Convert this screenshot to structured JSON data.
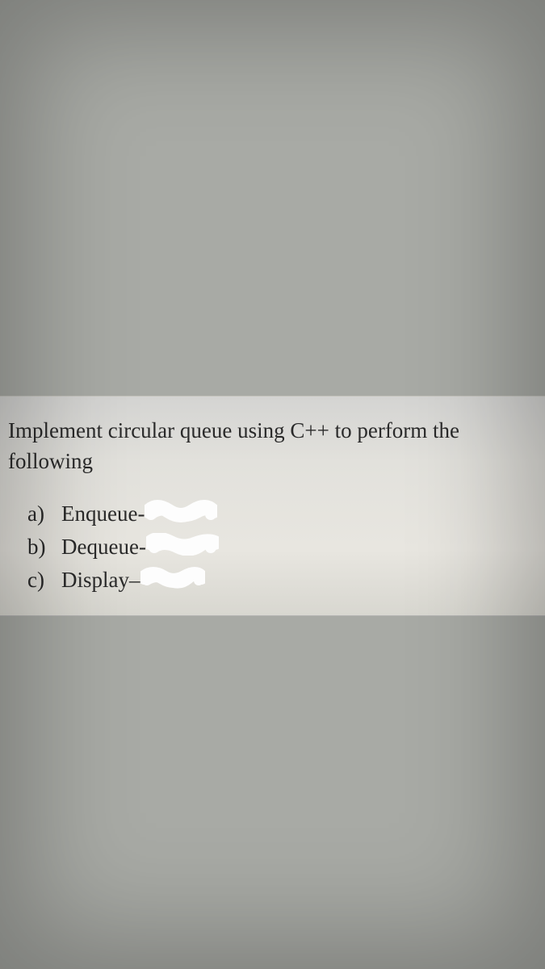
{
  "question": {
    "prompt": "Implement circular queue using C++ to perform the following",
    "items": [
      {
        "marker": "a)",
        "label": "Enqueue-"
      },
      {
        "marker": "b)",
        "label": "Dequeue-"
      },
      {
        "marker": "c)",
        "label": "Display"
      }
    ]
  }
}
